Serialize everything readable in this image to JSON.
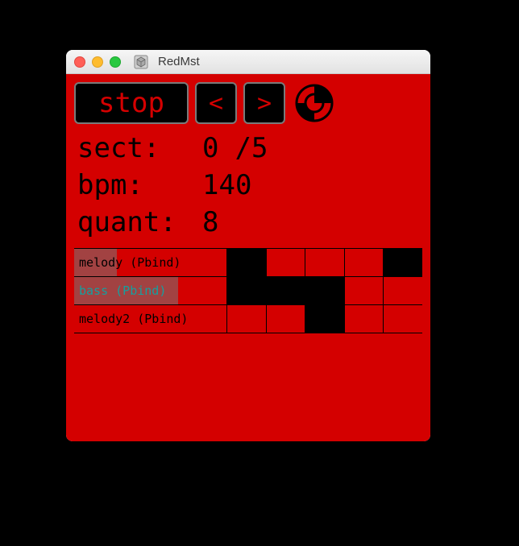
{
  "window": {
    "title": "RedMst"
  },
  "toolbar": {
    "stop_label": "stop",
    "prev_label": "<",
    "next_label": ">"
  },
  "info": {
    "sect_label": "sect:",
    "sect_index": "0",
    "sect_total": "/5",
    "bpm_label": "bpm:",
    "bpm_value": "140",
    "quant_label": "quant:",
    "quant_value": "8"
  },
  "tracks": [
    {
      "label": "melody (Pbind)",
      "teal": false,
      "cells": [
        false,
        true,
        true,
        true,
        false
      ],
      "overlay_pct": 28
    },
    {
      "label": "bass (Pbind)",
      "teal": true,
      "cells": [
        false,
        false,
        false,
        true,
        true
      ],
      "overlay_pct": 68
    },
    {
      "label": "melody2 (Pbind)",
      "teal": false,
      "cells": [
        true,
        true,
        false,
        true,
        true
      ],
      "overlay_pct": 0
    }
  ],
  "colors": {
    "accent_red": "#d40000",
    "black": "#000000",
    "teal": "#14a0a0"
  }
}
